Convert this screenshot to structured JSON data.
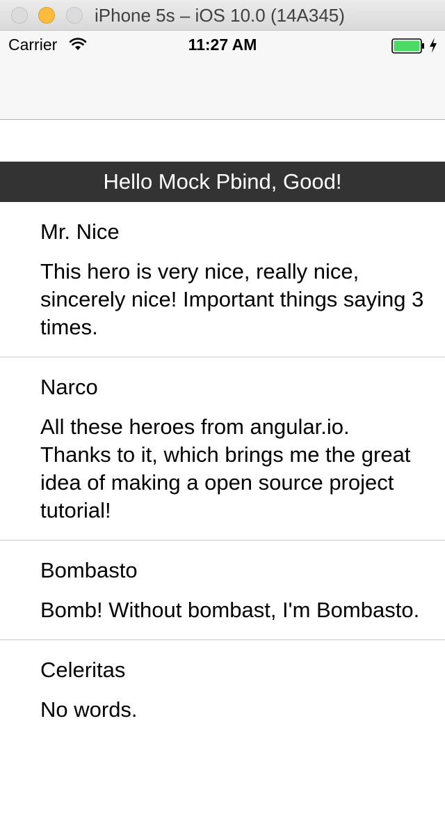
{
  "window": {
    "title": "iPhone 5s – iOS 10.0 (14A345)"
  },
  "status_bar": {
    "carrier": "Carrier",
    "time": "11:27 AM",
    "wifi_icon": "wifi-icon",
    "battery_icon": "battery-charging-icon",
    "battery_color": "#4cd964"
  },
  "header": {
    "text": "Hello Mock Pbind, Good!",
    "background": "#333333"
  },
  "heroes": [
    {
      "name": "Mr. Nice",
      "description": "This hero is very nice, really nice, sincerely nice! Important things saying 3 times."
    },
    {
      "name": "Narco",
      "description": "All these heroes from angular.io. Thanks to it, which brings me the great idea of making a open source project tutorial!"
    },
    {
      "name": "Bombasto",
      "description": "Bomb! Without bombast, I'm Bombasto."
    },
    {
      "name": "Celeritas",
      "description": "No words."
    }
  ]
}
